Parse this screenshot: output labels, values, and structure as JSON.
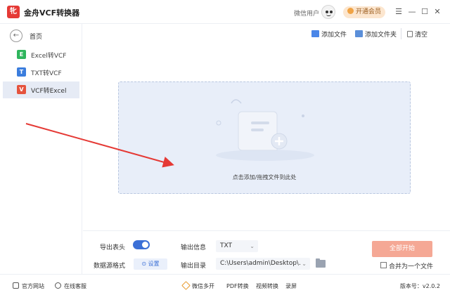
{
  "app": {
    "logo_text": "牝",
    "title": "金舟VCF转换器"
  },
  "header": {
    "user_name": "微信用户",
    "vip_label": "开通会员"
  },
  "window_controls": {
    "menu": "☰",
    "minimize": "—",
    "maximize": "☐",
    "close": "✕"
  },
  "sidebar": {
    "home_label": "首页",
    "items": [
      {
        "label": "Excel转VCF",
        "icon_text": "E",
        "color": "#2fb55d",
        "active": false
      },
      {
        "label": "TXT转VCF",
        "icon_text": "T",
        "color": "#3b7ddd",
        "active": false
      },
      {
        "label": "VCF转Excel",
        "icon_text": "V",
        "color": "#e5533d",
        "active": true
      }
    ]
  },
  "toolbar": {
    "add_file": "添加文件",
    "add_folder": "添加文件夹",
    "clear": "清空"
  },
  "dropzone": {
    "hint": "点击添加/拖拽文件到此处"
  },
  "options": {
    "export_header_label": "导出表头",
    "export_header_on": true,
    "source_format_label": "数据源格式",
    "settings_button": "设置",
    "output_info_label": "输出信息",
    "output_format": "TXT",
    "output_dir_label": "输出目录",
    "output_dir": "C:\\Users\\admin\\Desktop\\..."
  },
  "actions": {
    "start_all": "全部开始",
    "merge_label": "合并为一个文件",
    "merge_checked": false
  },
  "statusbar": {
    "website": "官方网站",
    "support": "在线客服",
    "wechat": "微信多开",
    "pdf": "PDF转换",
    "video": "视频转换",
    "record": "录屏",
    "version": "版本号：v2.0.2"
  },
  "colors": {
    "accent": "#3b6fd6",
    "start_button": "#f5a895",
    "arrow": "#e53935"
  }
}
